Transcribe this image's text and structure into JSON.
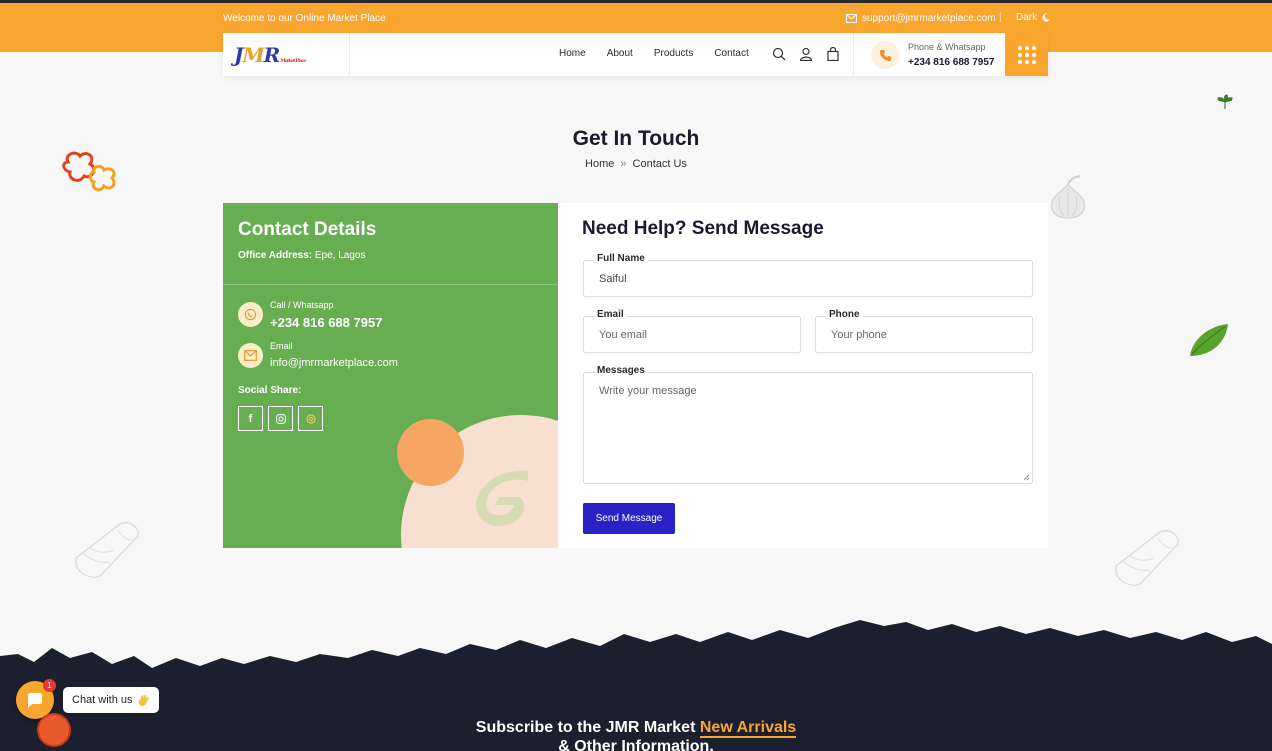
{
  "topbar": {
    "welcome": "Welcome to our Online Market Place",
    "support_email": "support@jmrmarketplace.com",
    "separator": "|",
    "dark_label": "Dark"
  },
  "nav": {
    "logo": {
      "j": "J",
      "m": "M",
      "r": "R",
      "market": "Market Place"
    },
    "items": [
      "Home",
      "About",
      "Products",
      "Contact"
    ],
    "phone_label": "Phone & Whatsapp",
    "phone_number": "+234 816 688 7957"
  },
  "page": {
    "title": "Get In Touch",
    "breadcrumb": {
      "home": "Home",
      "separator": "»",
      "current": "Contact Us"
    }
  },
  "contact": {
    "title": "Contact Details",
    "office_label": "Office Address:",
    "office_value": "Epe, Lagos",
    "call_label": "Call / Whatsapp",
    "call_value": "+234 816 688 7957",
    "email_label": "Email",
    "email_value": "info@jmrmarketplace.com",
    "social_label": "Social Share:",
    "social": [
      "f",
      "ig",
      "th"
    ]
  },
  "form": {
    "title": "Need Help? Send Message",
    "fullname_label": "Full Name",
    "fullname_value": "Saiful",
    "email_label": "Email",
    "email_placeholder": "You email",
    "phone_label": "Phone",
    "phone_placeholder": "Your phone",
    "message_label": "Messages",
    "message_placeholder": "Write your message",
    "submit_label": "Send Message"
  },
  "footer": {
    "subscribe_pre": "Subscribe to the JMR Market",
    "subscribe_highlight": "New Arrivals",
    "subscribe_post": "& Other Information."
  },
  "chat": {
    "label": "Chat with us",
    "badge": "1"
  },
  "colors": {
    "accent": "#f9a62f",
    "green": "#67ae52",
    "button": "#2a22c9",
    "dark_footer": "#1c1f2e"
  }
}
